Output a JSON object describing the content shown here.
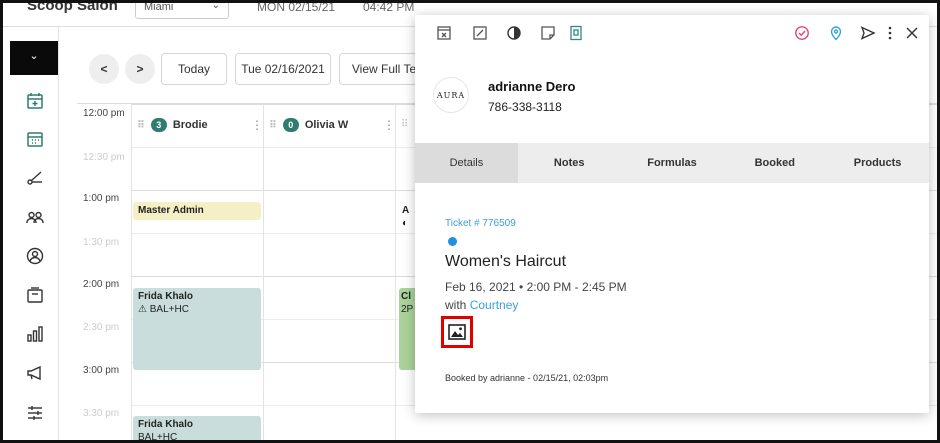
{
  "topbar": {
    "salon_name": "Scoop Salon",
    "location": "Miami",
    "date_text": "MON 02/15/21",
    "time_text": "04:42 PM"
  },
  "calendar": {
    "nav": {
      "prev_label": "<",
      "next_label": ">",
      "today_label": "Today",
      "date_label": "Tue 02/16/2021",
      "view_full_label": "View Full Te"
    },
    "times": [
      {
        "label": "12:00 pm",
        "faded": false
      },
      {
        "label": "12:30 pm",
        "faded": true
      },
      {
        "label": "1:00 pm",
        "faded": false
      },
      {
        "label": "1:30 pm",
        "faded": true
      },
      {
        "label": "2:00 pm",
        "faded": false
      },
      {
        "label": "2:30 pm",
        "faded": true
      },
      {
        "label": "3:00 pm",
        "faded": false
      },
      {
        "label": "3:30 pm",
        "faded": true
      }
    ],
    "staff": [
      {
        "name": "Brodie",
        "count": "3"
      },
      {
        "name": "Olivia W",
        "count": "0"
      }
    ],
    "appointments": {
      "master_admin": "Master Admin",
      "frida1_name": "Frida Khalo",
      "frida1_sub": "⚠ BAL+HC",
      "frida2_name": "Frida Khalo",
      "frida2_sub": "BAL+HC",
      "partial_a": "A",
      "partial_a_sub": "◐",
      "partial_c": "Cl",
      "partial_c_sub": "2P"
    }
  },
  "panel": {
    "client": {
      "logo_text": "AURA",
      "name": "adrianne Dero",
      "phone": "786-338-3118"
    },
    "tabs": [
      {
        "label": "Details",
        "active": true
      },
      {
        "label": "Notes",
        "active": false
      },
      {
        "label": "Formulas",
        "active": false
      },
      {
        "label": "Booked",
        "active": false
      },
      {
        "label": "Products",
        "active": false
      }
    ],
    "details": {
      "ticket": "Ticket # 776509",
      "service": "Women's Haircut",
      "time": "Feb 16, 2021 • 2:00 PM - 2:45 PM",
      "with_prefix": "with ",
      "stylist": "Courtney",
      "booked_by": "Booked by adrianne - 02/15/21, 02:03pm"
    }
  },
  "colors": {
    "status_dot": "#1e90e6",
    "link": "#3aa0d8",
    "highlight": "#e00000",
    "check_icon": "#e0457b",
    "pin_icon": "#3aa0d8",
    "sidebar_icon": "#2e7d6f"
  }
}
